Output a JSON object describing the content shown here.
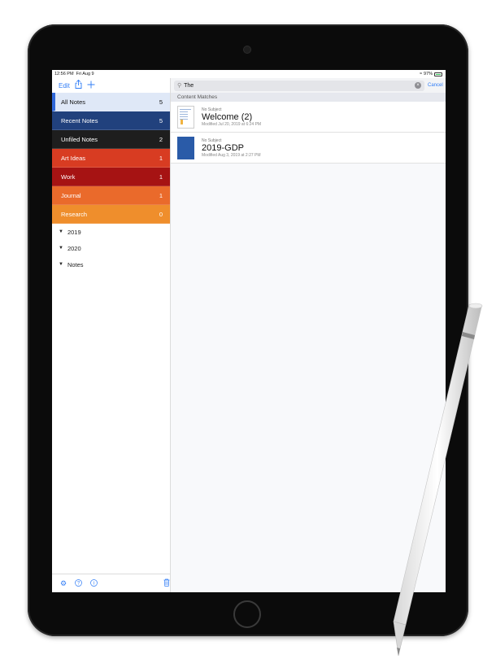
{
  "status_bar": {
    "time": "12:56 PM",
    "date": "Fri Aug 9",
    "battery": "97%"
  },
  "toolbar": {
    "edit_label": "Edit"
  },
  "notebooks": [
    {
      "name": "All Notes",
      "count": "5",
      "color": "#dfe8f7"
    },
    {
      "name": "Recent Notes",
      "count": "5",
      "color": "#21417d"
    },
    {
      "name": "Unfiled Notes",
      "count": "2",
      "color": "#1e1e1e"
    },
    {
      "name": "Art Ideas",
      "count": "1",
      "color": "#d83c22"
    },
    {
      "name": "Work",
      "count": "1",
      "color": "#a61313"
    },
    {
      "name": "Journal",
      "count": "1",
      "color": "#ea6a2b"
    },
    {
      "name": "Research",
      "count": "0",
      "color": "#ef8e2c"
    }
  ],
  "folders": [
    "2019",
    "2020",
    "Notes"
  ],
  "search": {
    "query": "The",
    "cancel_label": "Cancel"
  },
  "section_header": "Content Matches",
  "results": [
    {
      "subject": "No Subject",
      "title": "Welcome (2)",
      "modified": "Modified Jul 20, 2019 at 6:24 PM"
    },
    {
      "subject": "No Subject",
      "title": "2019-GDP",
      "modified": "Modified Aug 3, 2019 at 2:27 PM"
    }
  ]
}
